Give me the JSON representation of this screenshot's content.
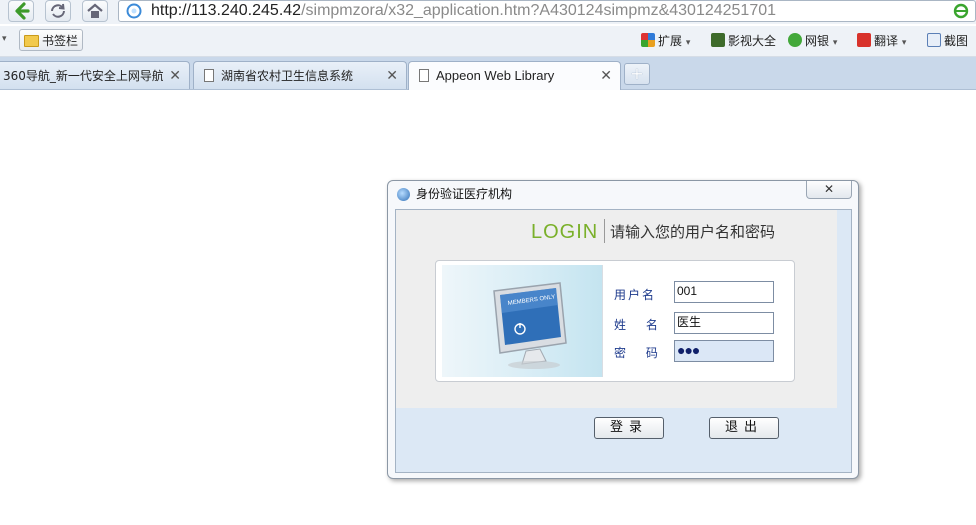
{
  "browser": {
    "url_host": "http://113.240.245.42",
    "url_rest": "/simpmzora/x32_application.htm?A430124simpmz&430124251701",
    "bookmarks_label": "书签栏",
    "tools": [
      {
        "label": "扩展",
        "icon": "extensions-icon"
      },
      {
        "label": "影视大全",
        "icon": "video-icon"
      },
      {
        "label": "网银",
        "icon": "bank-icon"
      },
      {
        "label": "翻译",
        "icon": "translate-icon"
      },
      {
        "label": "截图",
        "icon": "screenshot-icon"
      }
    ],
    "tabs": [
      {
        "label": "360导航_新一代安全上网导航",
        "active": false
      },
      {
        "label": "湖南省农村卫生信息系统",
        "active": false
      },
      {
        "label": "Appeon Web Library",
        "active": true
      }
    ]
  },
  "dialog": {
    "title": "身份验证医疗机构",
    "login_heading": "LOGIN",
    "subtitle": "请输入您的用户名和密码",
    "image_badge": "MEMBERS ONLY",
    "fields": {
      "username_label": "用户名",
      "username_value": "001",
      "name_label": "姓 名",
      "name_value": "医生",
      "password_label": "密 码",
      "password_value": "●●●"
    },
    "login_button": "登录",
    "exit_button": "退出"
  },
  "colors": {
    "login_accent": "#7ab02a",
    "label_blue": "#1d3a8c",
    "dialog_body": "#dce8f5"
  }
}
